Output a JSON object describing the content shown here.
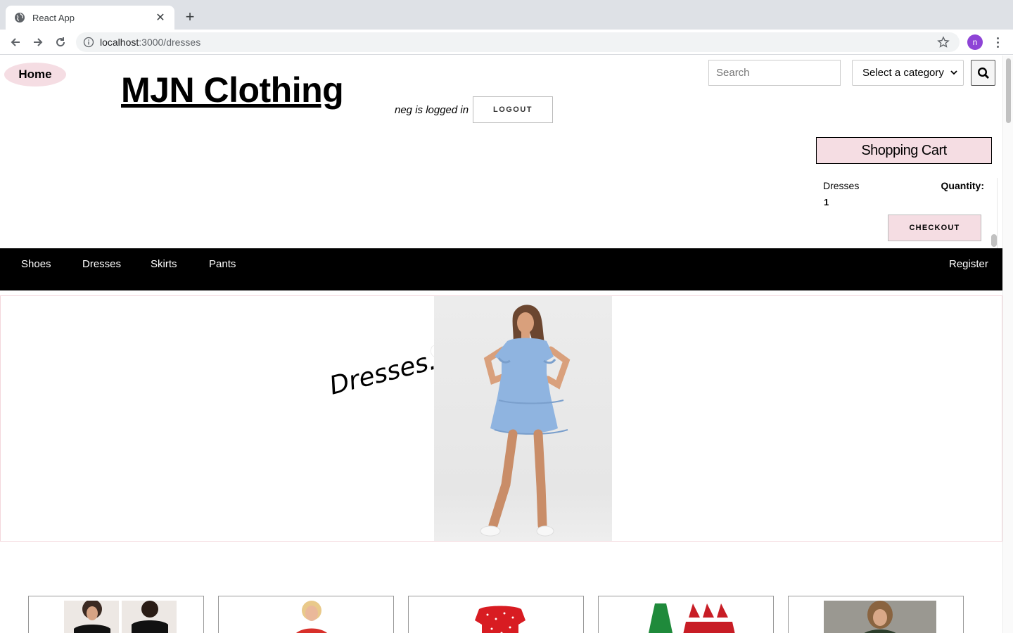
{
  "browser": {
    "tab_title": "React App",
    "url_host": "localhost",
    "url_path": ":3000/dresses",
    "profile_initial": "n"
  },
  "header": {
    "home_label": "Home",
    "site_title": "MJN Clothing",
    "logged_in_text": "neg is logged in",
    "logout_label": "LOGOUT",
    "search_placeholder": "Search",
    "category_selected": "Select a category"
  },
  "cart": {
    "title": "Shopping Cart",
    "items": [
      {
        "name": "Dresses",
        "quantity_label": "Quantity:",
        "quantity": "1"
      }
    ],
    "checkout_label": "CHECKOUT"
  },
  "nav": {
    "items": [
      {
        "label": "Shoes"
      },
      {
        "label": "Dresses"
      },
      {
        "label": "Skirts"
      },
      {
        "label": "Pants"
      }
    ],
    "register_label": "Register"
  },
  "banner": {
    "heading": "Dresses.."
  },
  "colors": {
    "accent_pink": "#f5dde3",
    "nav_bg": "#000000",
    "dress_blue": "#8fb4e0"
  }
}
